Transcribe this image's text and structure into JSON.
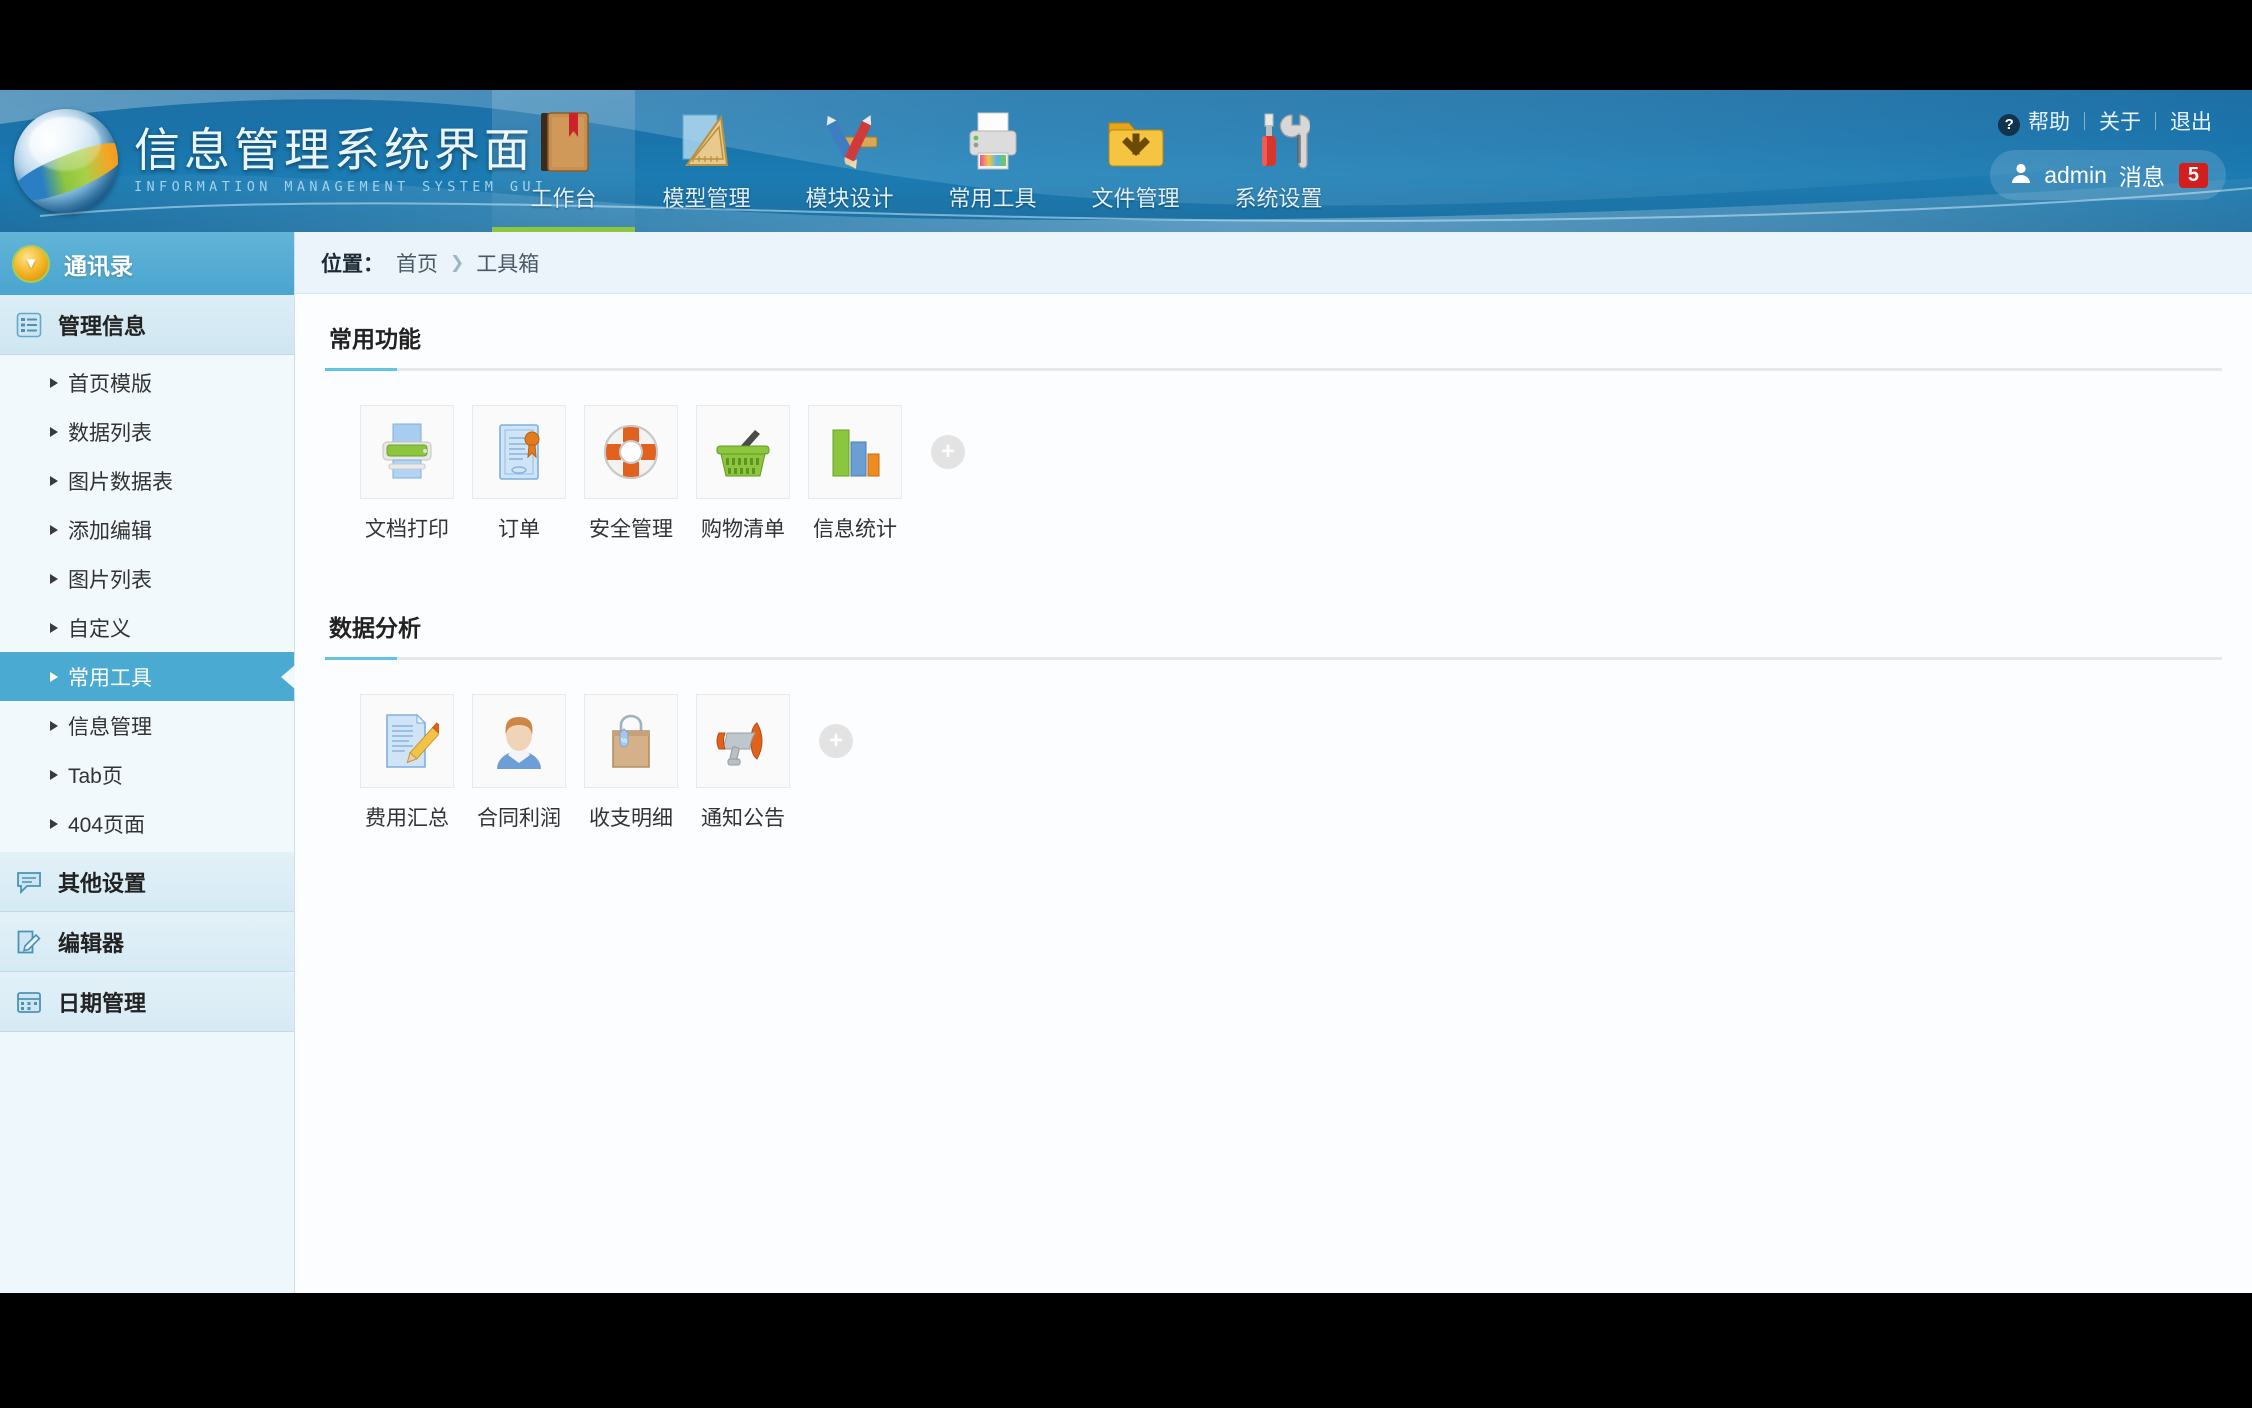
{
  "header": {
    "brand_title": "信息管理系统界面",
    "brand_subtitle": "INFORMATION MANAGEMENT SYSTEM GUI",
    "logo_icon": "globe-swirl-logo",
    "nav": [
      {
        "label": "工作台",
        "icon": "notebook-icon",
        "active": true
      },
      {
        "label": "模型管理",
        "icon": "ruler-triangle-icon",
        "active": false
      },
      {
        "label": "模块设计",
        "icon": "pencil-brush-icon",
        "active": false
      },
      {
        "label": "常用工具",
        "icon": "printer-icon",
        "active": false
      },
      {
        "label": "文件管理",
        "icon": "folder-download-icon",
        "active": false
      },
      {
        "label": "系统设置",
        "icon": "screwdriver-wrench-icon",
        "active": false
      }
    ],
    "links": [
      {
        "label": "帮助",
        "icon": "question-mark-icon"
      },
      {
        "label": "关于",
        "icon": ""
      },
      {
        "label": "退出",
        "icon": ""
      }
    ],
    "user": {
      "avatar_icon": "user-icon",
      "name": "admin",
      "message_label": "消息",
      "message_count": "5",
      "badge_color": "#d31e1e"
    }
  },
  "sidebar": {
    "head": {
      "label": "通讯录",
      "icon": "chevron-down-circle-icon"
    },
    "groups": [
      {
        "label": "管理信息",
        "icon": "list-icon",
        "items": [
          {
            "label": "首页模版",
            "active": false
          },
          {
            "label": "数据列表",
            "active": false
          },
          {
            "label": "图片数据表",
            "active": false
          },
          {
            "label": "添加编辑",
            "active": false
          },
          {
            "label": "图片列表",
            "active": false
          },
          {
            "label": "自定义",
            "active": false
          },
          {
            "label": "常用工具",
            "active": true
          },
          {
            "label": "信息管理",
            "active": false
          },
          {
            "label": "Tab页",
            "active": false
          },
          {
            "label": "404页面",
            "active": false
          }
        ]
      }
    ],
    "extra_groups": [
      {
        "label": "其他设置",
        "icon": "speech-bubble-icon"
      },
      {
        "label": "编辑器",
        "icon": "edit-square-icon"
      },
      {
        "label": "日期管理",
        "icon": "calendar-icon"
      }
    ]
  },
  "breadcrumb": {
    "label": "位置：",
    "items": [
      "首页",
      "工具箱"
    ],
    "separator": "❯"
  },
  "sections": [
    {
      "title": "常用功能",
      "add_button": "+",
      "tiles": [
        {
          "label": "文档打印",
          "icon": "printer-icon"
        },
        {
          "label": "订单",
          "icon": "certificate-icon"
        },
        {
          "label": "安全管理",
          "icon": "lifebuoy-icon"
        },
        {
          "label": "购物清单",
          "icon": "shopping-basket-icon"
        },
        {
          "label": "信息统计",
          "icon": "bar-chart-icon"
        }
      ]
    },
    {
      "title": "数据分析",
      "add_button": "+",
      "tiles": [
        {
          "label": "费用汇总",
          "icon": "document-pencil-icon"
        },
        {
          "label": "合同利润",
          "icon": "person-avatar-icon"
        },
        {
          "label": "收支明细",
          "icon": "shopping-bag-icon"
        },
        {
          "label": "通知公告",
          "icon": "megaphone-icon"
        }
      ]
    }
  ],
  "colors": {
    "header_blue": "#1b74ab",
    "accent_green": "#8dc63f",
    "sidebar_active": "#4aaad2",
    "rule_blue": "#63c3e2"
  }
}
